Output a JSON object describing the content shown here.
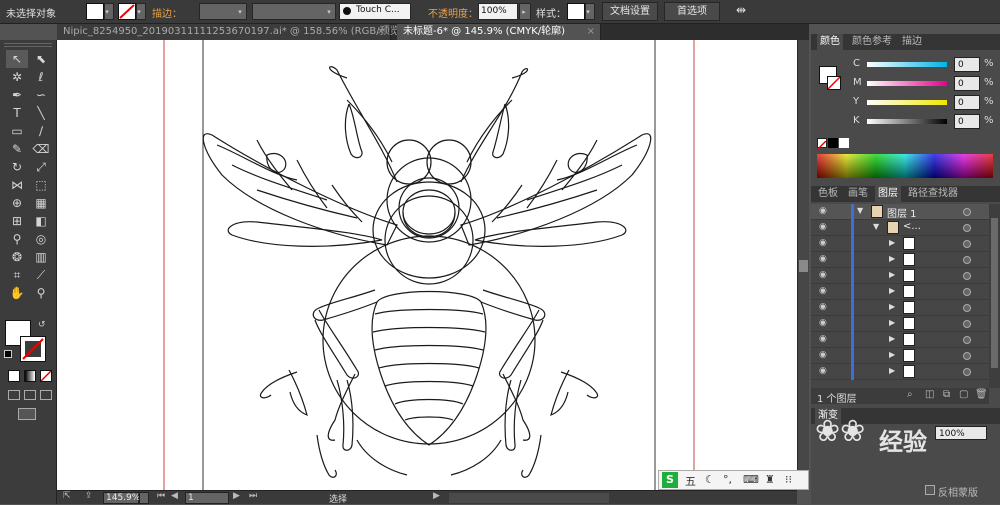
{
  "control_bar": {
    "selection_status": "未选择对象",
    "stroke_label": "描边：",
    "brush_name": "Touch C...",
    "opacity_label": "不透明度：",
    "opacity_value": "100%",
    "style_label": "样式：",
    "doc_setup": "文档设置",
    "preferences": "首选项"
  },
  "tabs": [
    {
      "label": "Nipic_8254950_20190311111253670197.ai* @ 158.56% (RGB/预览)",
      "active": false
    },
    {
      "label": "未标题-6* @ 145.9% (CMYK/轮廓)",
      "active": true
    }
  ],
  "color_panel": {
    "tabs": [
      "颜色",
      "颜色参考",
      "描边"
    ],
    "channels": [
      {
        "name": "C",
        "value": "0",
        "unit": "%",
        "color": "#00b4e6"
      },
      {
        "name": "M",
        "value": "0",
        "unit": "%",
        "color": "#e6008c"
      },
      {
        "name": "Y",
        "value": "0",
        "unit": "%",
        "color": "#f0e600"
      },
      {
        "name": "K",
        "value": "0",
        "unit": "%",
        "color": "#000000"
      }
    ]
  },
  "layers_panel": {
    "tabs": [
      "色板",
      "画笔",
      "图层",
      "路径查找器"
    ],
    "top_layer": "图层 1",
    "group_label": "<...",
    "sublayer_count": 9,
    "footer_count": "1 个图层"
  },
  "transparency_panel": {
    "tab": "渐变",
    "value": "100%",
    "invert_label": "反相蒙版"
  },
  "status_bar": {
    "zoom": "145.9%",
    "page": "1",
    "tool": "选择"
  },
  "ime": {
    "label": "五"
  },
  "watermark": "经验"
}
